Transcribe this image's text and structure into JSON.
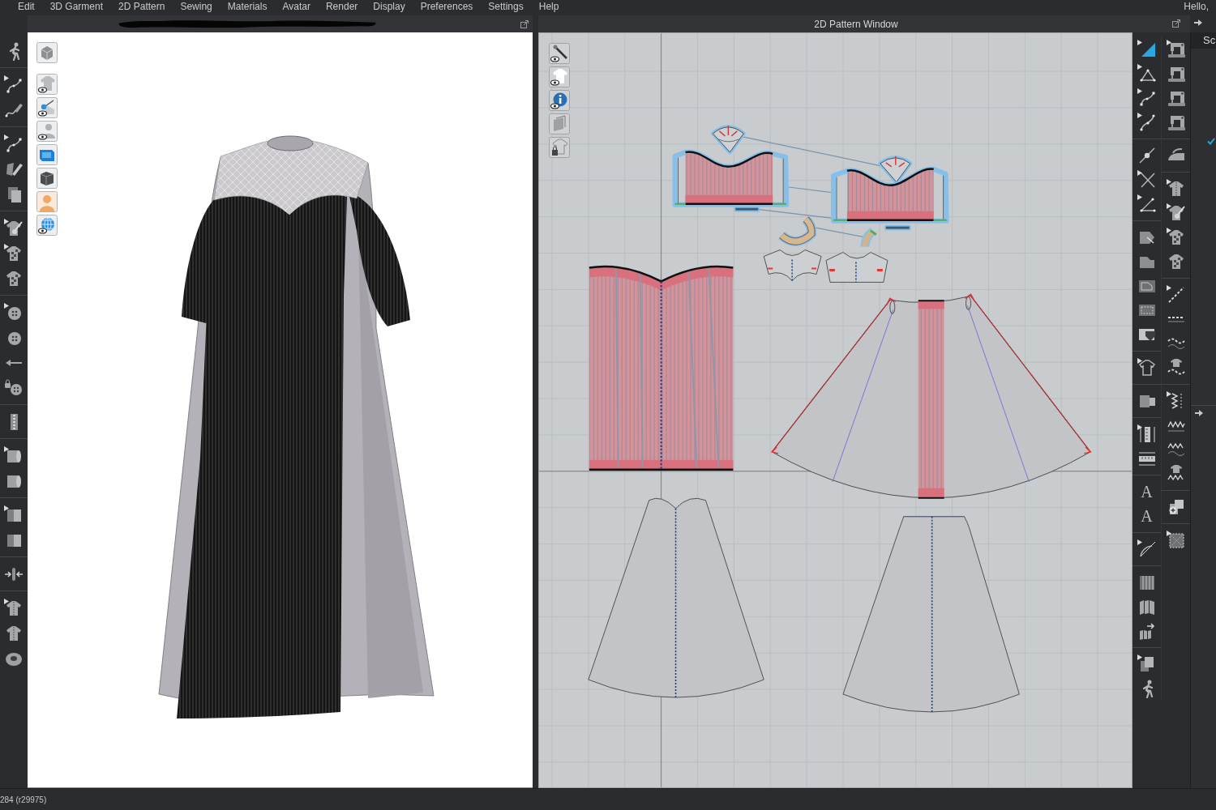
{
  "menu_bar": {
    "items": [
      "Edit",
      "3D Garment",
      "2D Pattern",
      "Sewing",
      "Materials",
      "Avatar",
      "Render",
      "Display",
      "Preferences",
      "Settings",
      "Help"
    ],
    "greeting": "Hello,"
  },
  "pattern_window": {
    "title": "2D Pattern Window"
  },
  "right_toolbar": {
    "text_tool_glyphs": [
      "A",
      "A"
    ]
  },
  "side_panel": {
    "title": "Sc"
  },
  "status_bar": {
    "text": "284 (r29975)"
  }
}
